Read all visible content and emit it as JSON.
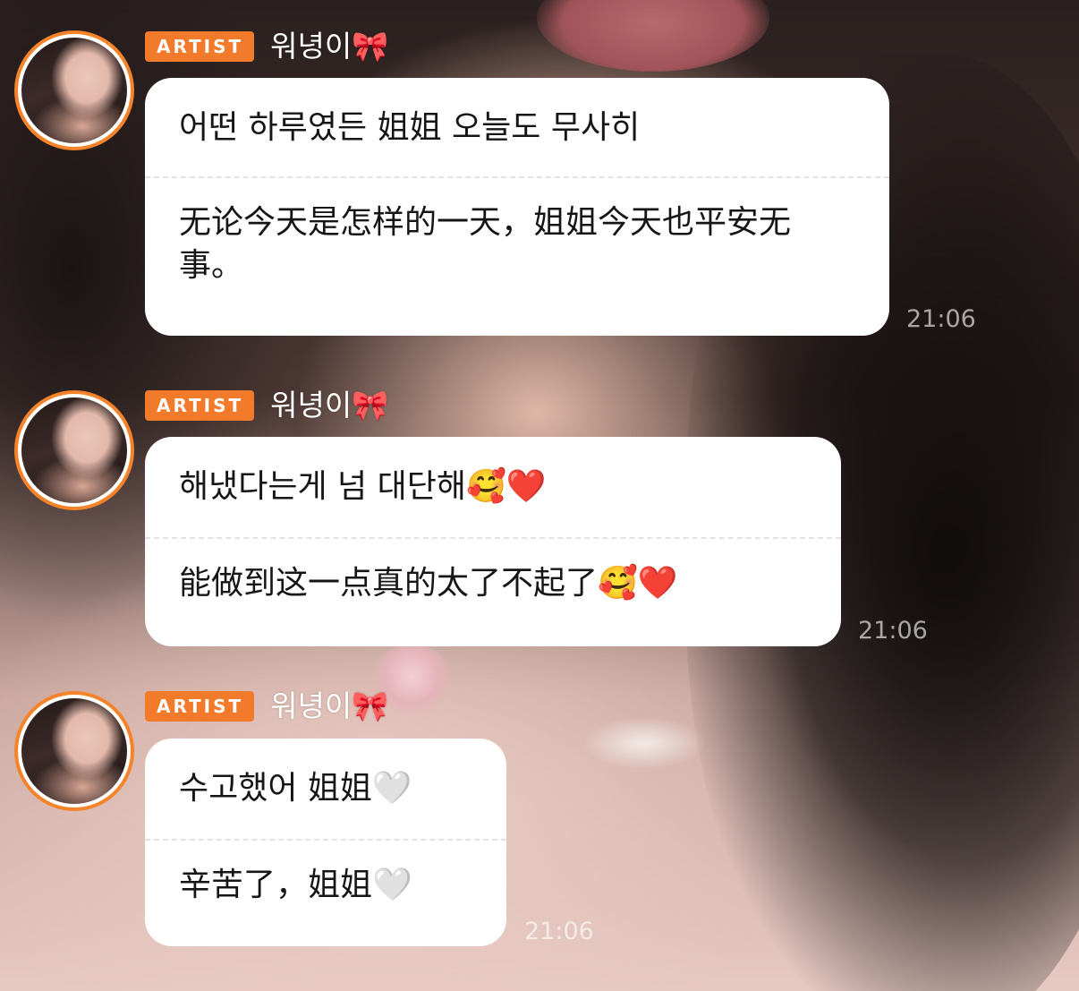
{
  "accent_color": "#f27a2b",
  "messages": [
    {
      "badge": "ARTIST",
      "username": "워녕이🎀",
      "original": "어떤 하루였든 姐姐 오늘도 무사히",
      "translation": "无论今天是怎样的一天，姐姐今天也平安无事。",
      "time": "21:06"
    },
    {
      "badge": "ARTIST",
      "username": "워녕이🎀",
      "original": "해냈다는게 넘 대단해🥰❤️",
      "translation": "能做到这一点真的太了不起了🥰❤️",
      "time": "21:06"
    },
    {
      "badge": "ARTIST",
      "username": "워녕이🎀",
      "original": "수고했어 姐姐🤍",
      "translation": "辛苦了，姐姐🤍",
      "time": "21:06"
    }
  ]
}
